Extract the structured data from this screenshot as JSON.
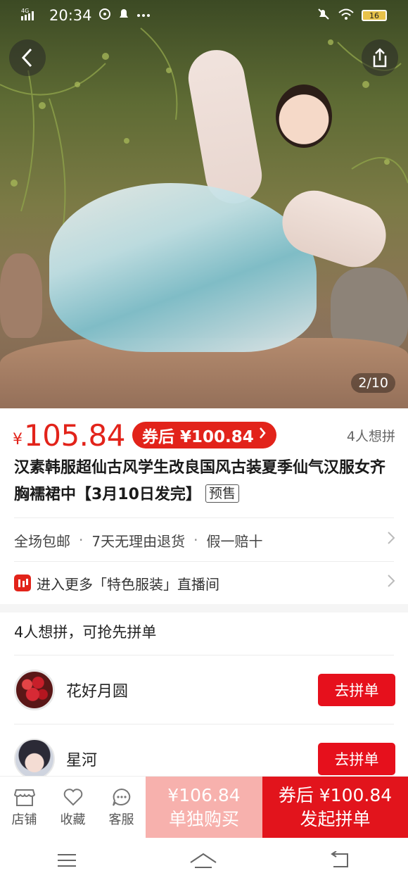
{
  "status_bar": {
    "network": "4G HD",
    "time": "20:34",
    "battery": "16"
  },
  "hero": {
    "counter": "2/10"
  },
  "price": {
    "symbol": "¥",
    "value": "105.84",
    "coupon_label": "券后 ¥100.84",
    "wish_count": "4人想拼"
  },
  "product": {
    "title": "汉素韩服超仙古风学生改良国风古装夏季仙气汉服女齐胸襦裙中【3月10日发完】",
    "presale_tag": "预售"
  },
  "services": [
    "全场包邮",
    "7天无理由退货",
    "假一赔十"
  ],
  "live": {
    "text": "进入更多「特色服装」直播间"
  },
  "group_buy": {
    "header": "4人想拼，可抢先拼单",
    "members": [
      {
        "name": "花好月圆",
        "button": "去拼单"
      },
      {
        "name": "星河",
        "button": "去拼单"
      }
    ]
  },
  "bottom_bar": {
    "tools": [
      {
        "label": "店铺",
        "icon": "store-icon"
      },
      {
        "label": "收藏",
        "icon": "heart-icon"
      },
      {
        "label": "客服",
        "icon": "chat-icon"
      }
    ],
    "single_price": "¥106.84",
    "single_label": "单独购买",
    "group_price": "券后 ¥100.84",
    "group_label": "发起拼单"
  },
  "colors": {
    "accent": "#e2231a",
    "single_buy_bg": "#f7b1ad",
    "group_buy_bg": "#e2141c"
  }
}
